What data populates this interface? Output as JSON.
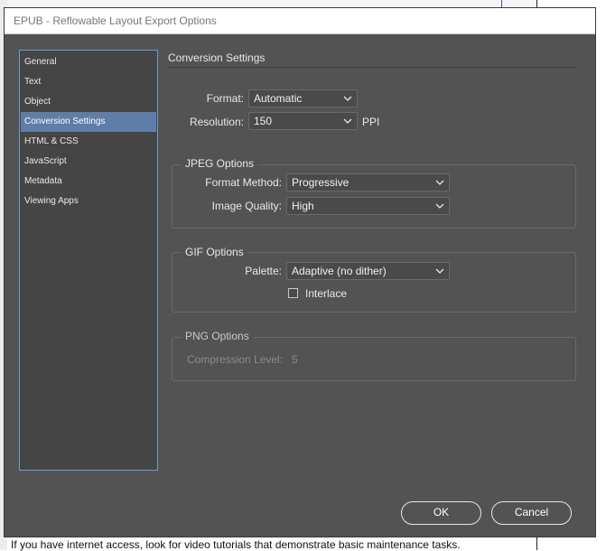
{
  "background": {
    "bottom_text": "If you have internet access, look for video tutorials that demonstrate basic maintenance tasks."
  },
  "dialog": {
    "title": "EPUB - Reflowable Layout Export Options"
  },
  "sidebar": {
    "items": [
      {
        "label": "General",
        "active": false
      },
      {
        "label": "Text",
        "active": false
      },
      {
        "label": "Object",
        "active": false
      },
      {
        "label": "Conversion Settings",
        "active": true
      },
      {
        "label": "HTML & CSS",
        "active": false
      },
      {
        "label": "JavaScript",
        "active": false
      },
      {
        "label": "Metadata",
        "active": false
      },
      {
        "label": "Viewing Apps",
        "active": false
      }
    ]
  },
  "main": {
    "section_title": "Conversion Settings",
    "format": {
      "label": "Format:",
      "value": "Automatic"
    },
    "resolution": {
      "label": "Resolution:",
      "value": "150",
      "unit": "PPI"
    },
    "jpeg": {
      "title": "JPEG Options",
      "format_method": {
        "label": "Format Method:",
        "value": "Progressive"
      },
      "image_quality": {
        "label": "Image Quality:",
        "value": "High"
      }
    },
    "gif": {
      "title": "GIF Options",
      "palette": {
        "label": "Palette:",
        "value": "Adaptive (no dither)"
      },
      "interlace": {
        "label": "Interlace",
        "checked": false
      }
    },
    "png": {
      "title": "PNG Options",
      "compression": {
        "label": "Compression Level:",
        "value": "5"
      }
    }
  },
  "buttons": {
    "ok": "OK",
    "cancel": "Cancel"
  },
  "colors": {
    "dialog_bg": "#535353",
    "sidebar_bg": "#454545",
    "active_item": "#5e7ea7",
    "sidebar_border": "#6b9bd1"
  },
  "icons": {
    "dropdown": "chevron-down-icon",
    "checkbox": "checkbox-unchecked"
  }
}
